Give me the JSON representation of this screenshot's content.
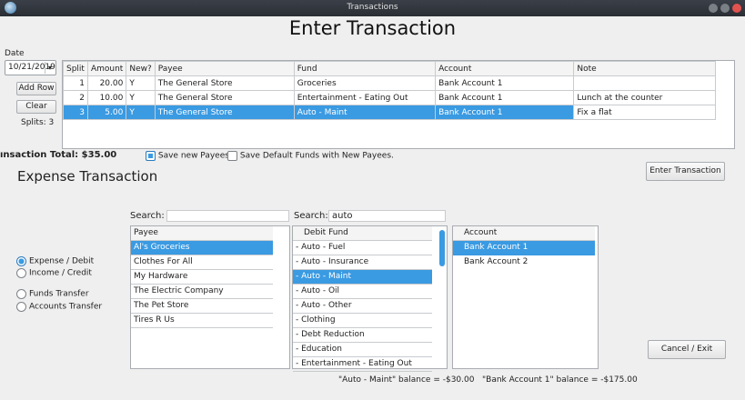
{
  "window": {
    "title": "Transactions"
  },
  "heading": "Enter Transaction",
  "date": {
    "label": "Date",
    "value": "10/21/2019",
    "dropdown_glyph": "▾"
  },
  "buttons": {
    "add_row": "Add Row",
    "clear": "Clear",
    "enter": "Enter Transaction",
    "cancel": "Cancel / Exit"
  },
  "splits_text": "Splits: 3",
  "grid": {
    "columns": [
      "Split",
      "Amount",
      "New?",
      "Payee",
      "Fund",
      "Account",
      "Note"
    ],
    "rows": [
      [
        "1",
        "20.00",
        "Y",
        "The General Store",
        "Groceries",
        "Bank Account 1",
        ""
      ],
      [
        "2",
        "10.00",
        "Y",
        "The General Store",
        "Entertainment - Eating Out",
        "Bank Account 1",
        "Lunch at the counter"
      ],
      [
        "3",
        "5.00",
        "Y",
        "The General Store",
        "Auto - Maint",
        "Bank Account 1",
        "Fix a flat"
      ]
    ],
    "selected_row": 2
  },
  "total_text": "ınsaction Total: $35.00",
  "save_new_payees": {
    "label": "Save new Payees.",
    "checked": true
  },
  "save_default_funds": {
    "label": "Save Default Funds with New Payees.",
    "checked": false
  },
  "section_title": "Expense Transaction",
  "transaction_types": [
    {
      "label": "Expense / Debit",
      "selected": true
    },
    {
      "label": "Income / Credit",
      "selected": false
    },
    {
      "label": "Funds Transfer",
      "selected": false
    },
    {
      "label": "Accounts Transfer",
      "selected": false
    }
  ],
  "payee_search": {
    "label": "Search:",
    "value": ""
  },
  "fund_search": {
    "label": "Search:",
    "value": "auto"
  },
  "payee_list": {
    "header": "Payee",
    "items": [
      "Al's Groceries",
      "Clothes For All",
      "My Hardware",
      "The Electric Company",
      "The Pet Store",
      "Tires R Us"
    ],
    "selected": 0
  },
  "fund_list": {
    "header": "Debit Fund",
    "items": [
      "-   Auto - Fuel",
      "-   Auto - Insurance",
      "-   Auto - Maint",
      "-   Auto - Oil",
      "-   Auto - Other",
      "-   Clothing",
      "-   Debt Reduction",
      "-   Education",
      "-   Entertainment - Eating Out"
    ],
    "selected": 2
  },
  "account_list": {
    "header": "Account",
    "items": [
      "Bank Account 1",
      "Bank Account 2"
    ],
    "selected": 0
  },
  "fund_balance": "\"Auto - Maint\" balance = -$30.00",
  "account_balance": "\"Bank Account 1\" balance = -$175.00",
  "colors": {
    "selection": "#3a9ae2",
    "titlebar": "#2f333a"
  }
}
